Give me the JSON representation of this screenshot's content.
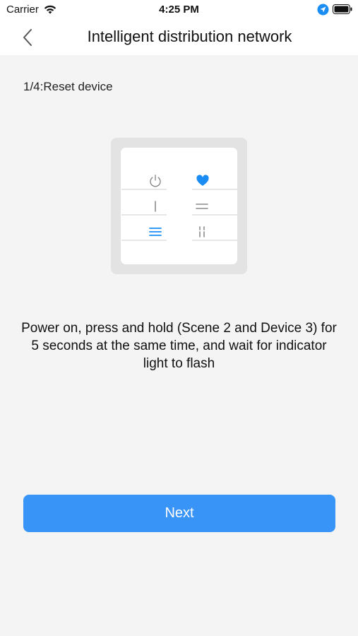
{
  "status_bar": {
    "carrier": "Carrier",
    "time": "4:25 PM"
  },
  "nav": {
    "title": "Intelligent distribution network",
    "back_icon": "chevron-left-icon"
  },
  "step": {
    "label": "1/4:Reset device"
  },
  "device_illustration": {
    "buttons": [
      {
        "icon": "power-icon",
        "highlighted": false
      },
      {
        "icon": "heart-icon",
        "highlighted": true
      },
      {
        "icon": "single-line-icon",
        "highlighted": false
      },
      {
        "icon": "double-line-icon",
        "highlighted": false
      },
      {
        "icon": "triple-line-icon",
        "highlighted": true
      },
      {
        "icon": "pause-icon",
        "highlighted": false
      }
    ]
  },
  "instruction": "Power on, press and hold (Scene 2 and Device 3) for 5 seconds at the same time, and wait for indicator light to flash",
  "actions": {
    "next_label": "Next"
  },
  "colors": {
    "accent": "#3994f8",
    "background": "#f4f4f4",
    "highlight_icon": "#1a8df5",
    "inactive_icon": "#8a8a8a"
  }
}
